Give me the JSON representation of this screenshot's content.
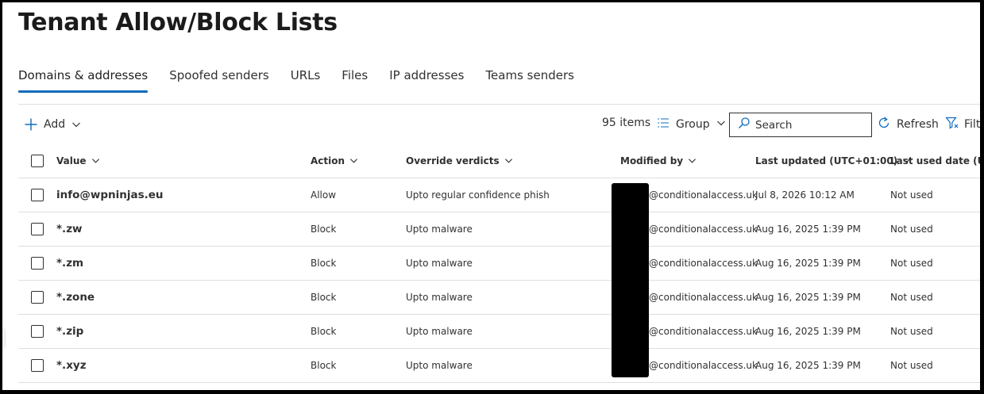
{
  "page": {
    "title": "Tenant Allow/Block Lists"
  },
  "tabs": [
    {
      "label": "Domains & addresses",
      "active": true
    },
    {
      "label": "Spoofed senders",
      "active": false
    },
    {
      "label": "URLs",
      "active": false
    },
    {
      "label": "Files",
      "active": false
    },
    {
      "label": "IP addresses",
      "active": false
    },
    {
      "label": "Teams senders",
      "active": false
    }
  ],
  "toolbar": {
    "add_label": "Add",
    "item_count": "95 items",
    "group_label": "Group",
    "search_placeholder": "Search",
    "refresh_label": "Refresh",
    "filter_label": "Filt",
    "accent_color": "#0f6cbd"
  },
  "table": {
    "columns": {
      "value": "Value",
      "action": "Action",
      "override": "Override verdicts",
      "modified": "Modified by",
      "updated": "Last updated (UTC+01:00)",
      "lastused": "Last used date (UTC+"
    },
    "rows": [
      {
        "value": "info@wpninjas.eu",
        "action": "Allow",
        "override": "Upto regular confidence phish",
        "modified": "@conditionalaccess.uk",
        "updated": "Jul 8, 2026 10:12 AM",
        "lastused": "Not used"
      },
      {
        "value": "*.zw",
        "action": "Block",
        "override": "Upto malware",
        "modified": "@conditionalaccess.uk",
        "updated": "Aug 16, 2025 1:39 PM",
        "lastused": "Not used"
      },
      {
        "value": "*.zm",
        "action": "Block",
        "override": "Upto malware",
        "modified": "@conditionalaccess.uk",
        "updated": "Aug 16, 2025 1:39 PM",
        "lastused": "Not used"
      },
      {
        "value": "*.zone",
        "action": "Block",
        "override": "Upto malware",
        "modified": "@conditionalaccess.uk",
        "updated": "Aug 16, 2025 1:39 PM",
        "lastused": "Not used"
      },
      {
        "value": "*.zip",
        "action": "Block",
        "override": "Upto malware",
        "modified": "@conditionalaccess.uk",
        "updated": "Aug 16, 2025 1:39 PM",
        "lastused": "Not used"
      },
      {
        "value": "*.xyz",
        "action": "Block",
        "override": "Upto malware",
        "modified": "@conditionalaccess.uk",
        "updated": "Aug 16, 2025 1:39 PM",
        "lastused": "Not used"
      }
    ]
  }
}
